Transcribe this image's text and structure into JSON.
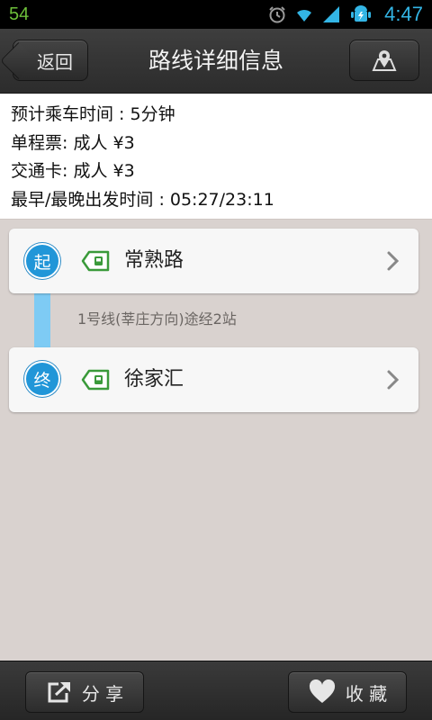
{
  "status_bar": {
    "left_number": "54",
    "time": "4:47"
  },
  "header": {
    "back_label": "返回",
    "title": "路线详细信息"
  },
  "info": {
    "travel_time": "预计乘车时间 : 5分钟",
    "single_ticket": "单程票: 成人 ¥3",
    "transport_card": "交通卡: 成人 ¥3",
    "departure_times": "最早/最晚出发时间 : 05:27/23:11"
  },
  "route": {
    "start_badge": "起",
    "end_badge": "终",
    "start_station": "常熟路",
    "end_station": "徐家汇",
    "segment_info": "1号线(莘庄方向)途经2站"
  },
  "footer": {
    "share_label": "分 享",
    "favorite_label": "收 藏"
  },
  "colors": {
    "accent_blue": "#2196d8",
    "route_line": "#7ecbf4",
    "station_tag_green": "#3a9a3a",
    "background": "#d9d2cf"
  },
  "icons": {
    "back": "back-arrow-icon",
    "map": "map-pin-icon",
    "station_tag": "station-tag-icon",
    "chevron": "chevron-right-icon",
    "share": "share-icon",
    "favorite": "heart-icon"
  }
}
